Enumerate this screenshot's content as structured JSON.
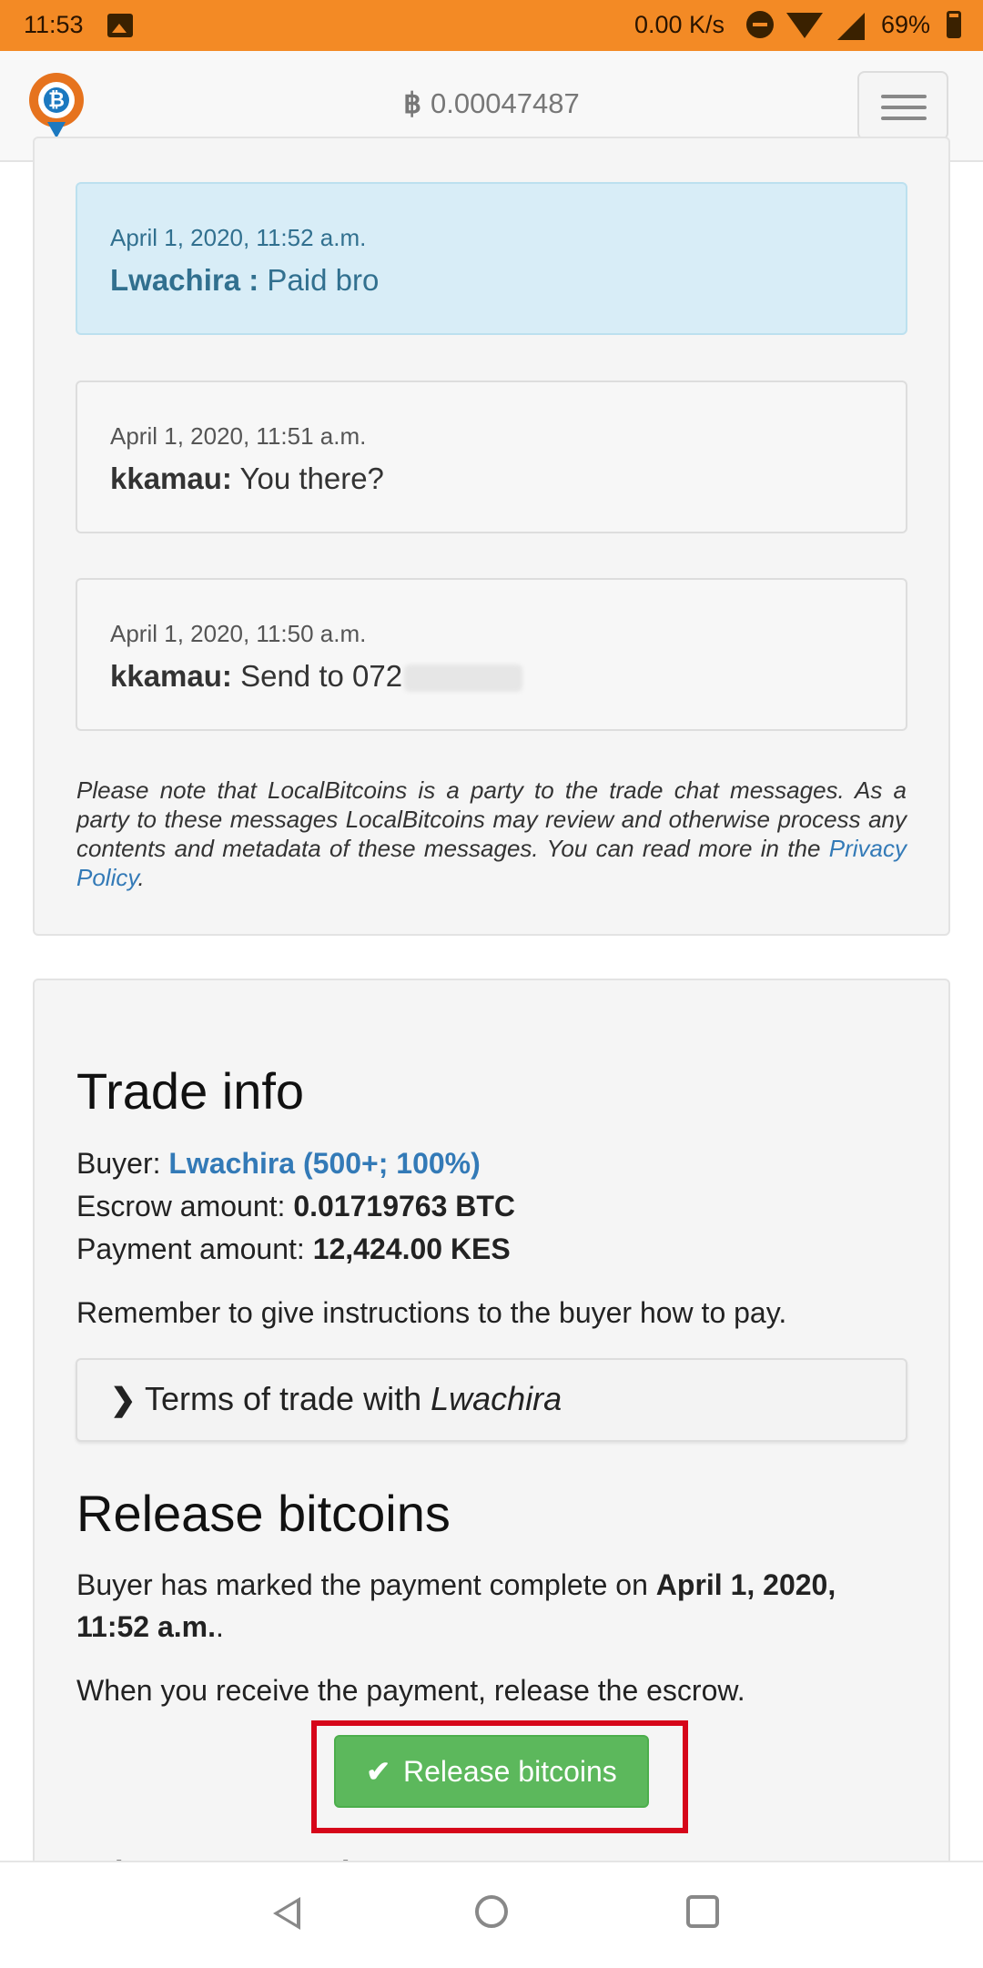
{
  "status_bar": {
    "time": "11:53",
    "net_speed": "0.00 K/s",
    "battery": "69%"
  },
  "header": {
    "btc_symbol": "฿",
    "balance": "0.00047487"
  },
  "chat": {
    "messages": [
      {
        "date": "April 1, 2020, 11:52 a.m.",
        "sender": "Lwachira :",
        "text": "Paid bro",
        "highlight": true
      },
      {
        "date": "April 1, 2020, 11:51 a.m.",
        "sender": "kkamau:",
        "text": "You there?",
        "highlight": false
      },
      {
        "date": "April 1, 2020, 11:50 a.m.",
        "sender": "kkamau:",
        "text": "Send to 072",
        "highlight": false
      }
    ],
    "notice": "Please note that LocalBitcoins is a party to the trade chat messages. As a party to these messages LocalBitcoins may review and otherwise process any contents and metadata of these messages. You can read more in the",
    "notice_link": "Privacy Policy",
    "notice_end": "."
  },
  "trade_info": {
    "title": "Trade info",
    "buyer_label": "Buyer:",
    "buyer_value": "Lwachira (500+; 100%)",
    "escrow_label": "Escrow amount:",
    "escrow_value": "0.01719763 BTC",
    "payment_label": "Payment amount:",
    "payment_value": "12,424.00 KES",
    "reminder": "Remember to give instructions to the buyer how to pay.",
    "terms_label": "Terms of trade with",
    "terms_user": "Lwachira"
  },
  "release": {
    "title": "Release bitcoins",
    "marked_text": "Buyer has marked the payment complete on",
    "marked_date": "April 1, 2020, 11:52 a.m.",
    "marked_end": ".",
    "instruction": "When you receive the payment, release the escrow.",
    "button_label": "Release bitcoins",
    "next_heading": "Dispute trade"
  },
  "colors": {
    "status_bar": "#f38a25",
    "link": "#337ab7",
    "button_green": "#5cb85c",
    "highlight_red": "#d6061a"
  }
}
